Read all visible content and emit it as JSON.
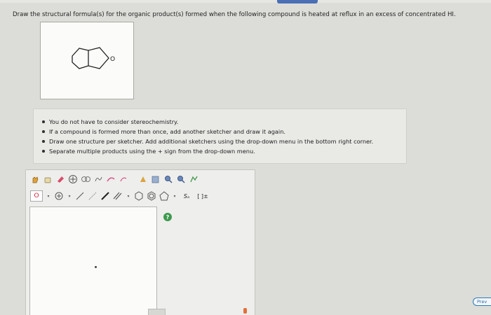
{
  "question": {
    "text": "Draw the structural formula(s) for the organic product(s) formed when the following compound is heated at reflux in an excess of concentrated HI."
  },
  "structure": {
    "atom_label": "O"
  },
  "instructions": [
    "You do not have to consider stereochemistry.",
    "If a compound is formed more than once, add another sketcher and draw it again.",
    "Draw one structure per sketcher. Add additional sketchers using the drop-down menu in the bottom right corner.",
    "Separate multiple products using the + sign from the drop-down menu."
  ],
  "sketcher": {
    "atom_selector": "O",
    "help_label": "?",
    "toolbar_row1_icons": [
      "hand-icon",
      "bag-icon",
      "eraser-icon",
      "add-ring-icon",
      "template-icon",
      "charge-icon",
      "arrow-icon",
      "redo-icon",
      "clean-icon",
      "import-icon",
      "zoom-in-icon",
      "zoom-out-icon",
      "settings-icon"
    ],
    "toolbar_row2_icons": [
      "atom-o-icon",
      "plus-icon",
      "single-bond-icon",
      "wedge-bond-icon",
      "bold-bond-icon",
      "hash-bond-icon",
      "benzene-icon",
      "cyclohexane-icon",
      "cyclopentane-icon",
      "text-icon",
      "bracket-icon"
    ],
    "text_tool_label": "Sₐ",
    "bracket_label": "[ ]±"
  },
  "navigation": {
    "prev_label": "Prev"
  },
  "colors": {
    "help_green": "#3e9a4e",
    "oxygen_red": "#c23",
    "link_blue": "#2a7bb8"
  }
}
